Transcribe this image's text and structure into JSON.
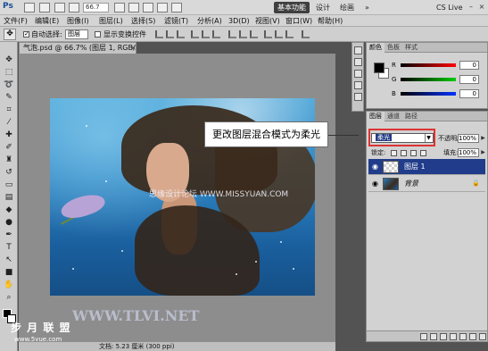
{
  "appbar": {
    "logo": "Ps",
    "zoom": "66.7",
    "workspaces": [
      "基本功能",
      "设计",
      "绘画"
    ],
    "cs_live": "CS Live",
    "window_controls": [
      "–",
      "□",
      "×"
    ]
  },
  "menu": [
    "文件(F)",
    "编辑(E)",
    "图像(I)",
    "图层(L)",
    "选择(S)",
    "滤镜(T)",
    "分析(A)",
    "3D(D)",
    "视图(V)",
    "窗口(W)",
    "帮助(H)"
  ],
  "options": {
    "auto_select_label": "自动选择:",
    "auto_select_value": "图层",
    "show_transform_label": "显示变换控件"
  },
  "document": {
    "tab_title": "气泡.psd @ 66.7% (图层 1, RGB/8*) *",
    "close": "×",
    "status": "文档: 5.23 厘米 (300 ppi)"
  },
  "callout": "更改图层混合模式为柔光",
  "watermarks": {
    "site": "思缘设计论坛 WWW.MISSYUAN.COM",
    "tlvi": "WWW.TLVI.NET",
    "logo": "步 月 联 盟",
    "logo_sub": "www.5yue.com"
  },
  "color_panel": {
    "tabs": [
      "颜色",
      "色板",
      "样式"
    ],
    "channels": [
      {
        "label": "R",
        "value": "0",
        "color": "#e02020"
      },
      {
        "label": "G",
        "value": "0",
        "color": "#20b020"
      },
      {
        "label": "B",
        "value": "0",
        "color": "#2040e0"
      }
    ]
  },
  "layers_panel": {
    "tabs": [
      "图层",
      "通道",
      "路径"
    ],
    "blend_mode": "柔光",
    "opacity_label": "不透明度:",
    "opacity": "100%",
    "lock_label": "锁定:",
    "fill_label": "填充:",
    "fill": "100%",
    "layers": [
      {
        "name": "图层 1",
        "selected": true
      },
      {
        "name": "背景",
        "selected": false
      }
    ]
  },
  "colors": {
    "selection": "#203c8a",
    "highlight": "#dd3333",
    "chrome": "#d2d2d2"
  }
}
